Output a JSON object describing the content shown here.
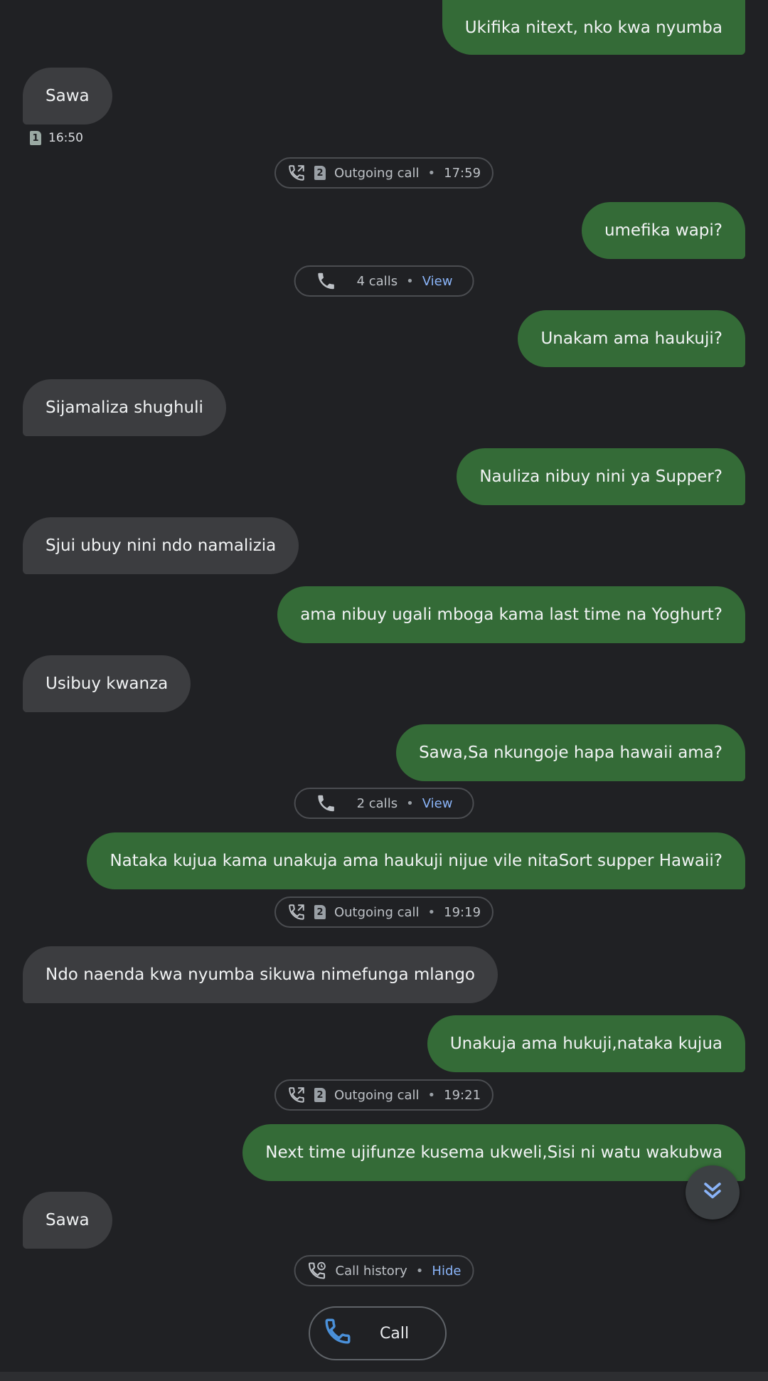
{
  "messages": [
    {
      "dir": "out",
      "text": "Ukifika nitext, nko kwa nyumba"
    },
    {
      "dir": "in",
      "text": "Sawa"
    },
    {
      "dir": "out",
      "text": "umefika wapi?"
    },
    {
      "dir": "out",
      "text": "Unakam ama haukuji?"
    },
    {
      "dir": "in",
      "text": "Sijamaliza shughuli"
    },
    {
      "dir": "out",
      "text": "Nauliza nibuy nini ya Supper?"
    },
    {
      "dir": "in",
      "text": "Sjui ubuy nini ndo namalizia"
    },
    {
      "dir": "out",
      "text": "ama nibuy ugali mboga kama last time na Yoghurt?"
    },
    {
      "dir": "in",
      "text": "Usibuy kwanza"
    },
    {
      "dir": "out",
      "text": "Sawa,Sa nkungoje hapa hawaii ama?"
    },
    {
      "dir": "out",
      "text": "Nataka kujua kama unakuja ama haukuji nijue vile nitaSort supper Hawaii?"
    },
    {
      "dir": "in",
      "text": "Ndo naenda kwa nyumba sikuwa nimefunga mlango"
    },
    {
      "dir": "out",
      "text": "Unakuja ama hukuji,nataka kujua"
    },
    {
      "dir": "out",
      "text": "Next time ujifunze kusema ukweli,Sisi ni watu wakubwa"
    },
    {
      "dir": "in",
      "text": "Sawa"
    }
  ],
  "timestamp": {
    "sim": "1",
    "time": "16:50"
  },
  "calls": [
    {
      "sim": "2",
      "label": "Outgoing call",
      "sep": "•",
      "time": "17:59"
    },
    {
      "label": "4 calls",
      "sep": "•",
      "link": "View"
    },
    {
      "label": "2 calls",
      "sep": "•",
      "link": "View"
    },
    {
      "sim": "2",
      "label": "Outgoing call",
      "sep": "•",
      "time": "19:19"
    },
    {
      "sim": "2",
      "label": "Outgoing call",
      "sep": "•",
      "time": "19:21"
    }
  ],
  "history": {
    "label": "Call history",
    "sep": "•",
    "link": "Hide"
  },
  "call_button": {
    "label": "Call"
  },
  "icons": {
    "outgoing": "outgoing-call-icon",
    "phone": "phone-icon",
    "history": "call-history-icon",
    "scroll": "double-chevron-down-icon"
  },
  "colors": {
    "background": "#202124",
    "outgoing_bubble": "#346b37",
    "incoming_bubble": "#3c3d40",
    "link": "#8ab4f8",
    "call_icon": "#4a90d9"
  }
}
